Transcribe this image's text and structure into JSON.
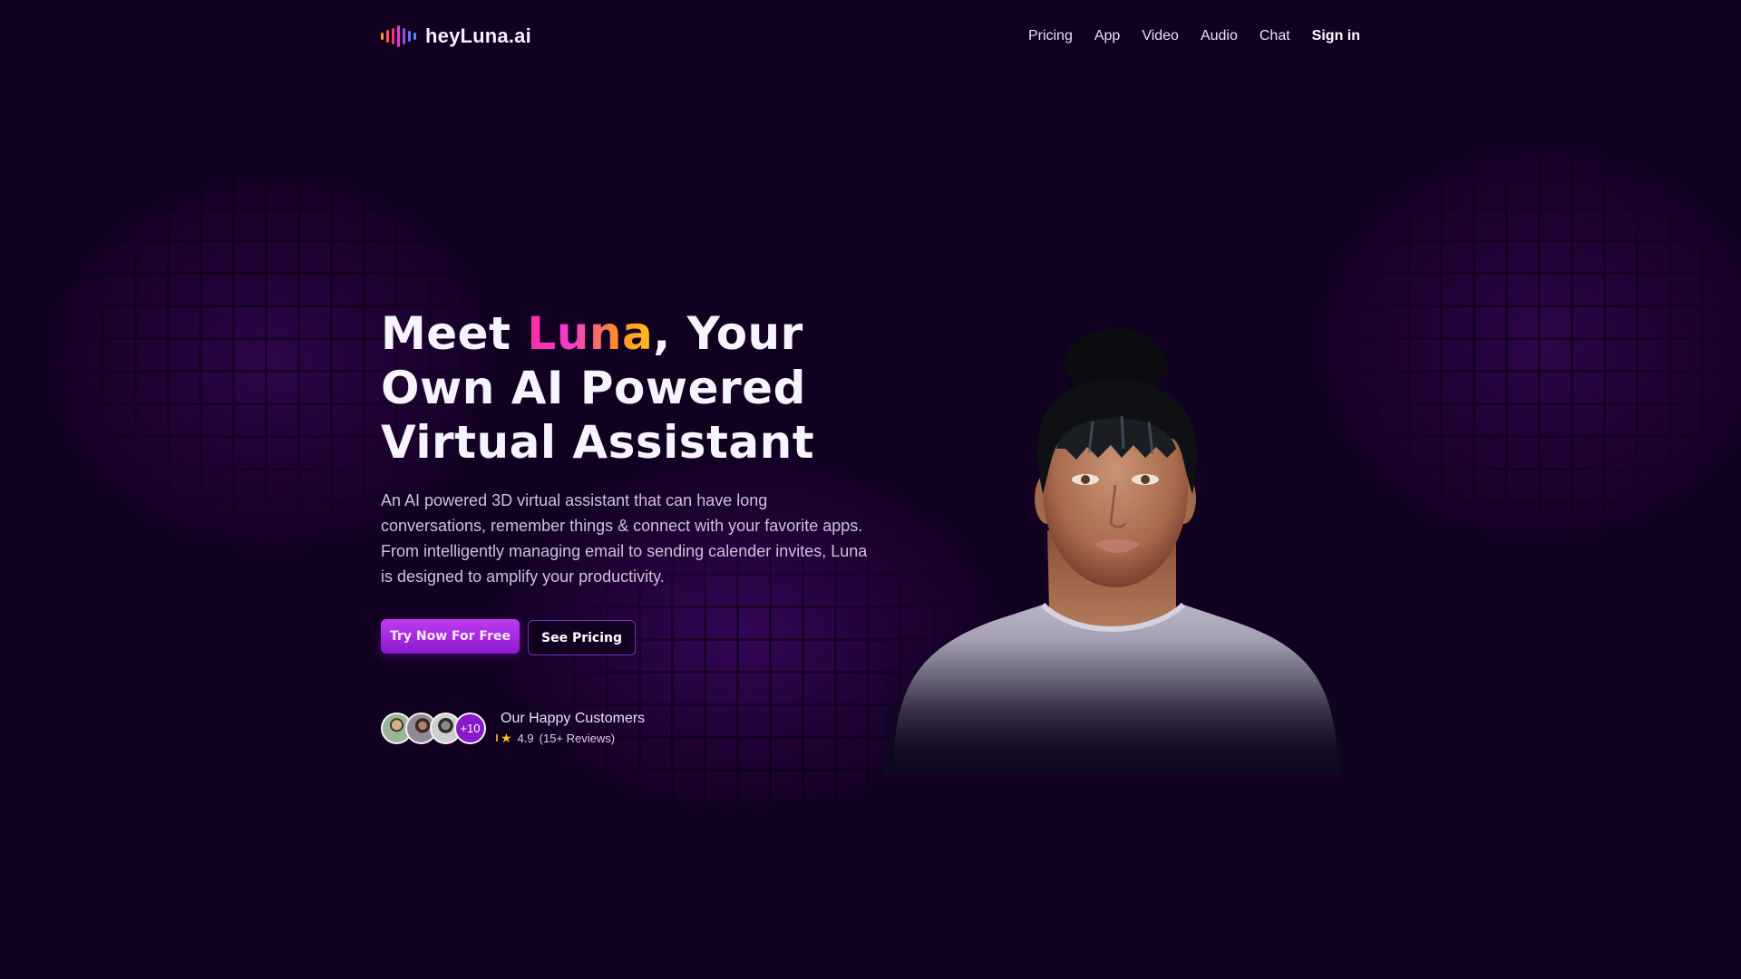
{
  "brand": {
    "name": "heyLuna.ai",
    "logo_icon": "sound-wave-icon",
    "logo_bar_colors": [
      "#ff9a2a",
      "#ff5a3a",
      "#ff2f7a",
      "#e23cd0",
      "#9a4cf0",
      "#6a6cff",
      "#4a8cff"
    ]
  },
  "nav": {
    "links": [
      {
        "label": "Pricing"
      },
      {
        "label": "App"
      },
      {
        "label": "Video"
      },
      {
        "label": "Audio"
      },
      {
        "label": "Chat"
      }
    ],
    "signin_label": "Sign in"
  },
  "hero": {
    "title_before": "Meet ",
    "title_accent": "Luna",
    "title_after": ", Your Own AI Powered Virtual Assistant",
    "description": "An AI powered 3D virtual assistant that can have long conversations, remember things & connect with your favorite apps. From intelligently managing email to sending calender invites, Luna is designed to amplify your productivity.",
    "primary_button": "Try Now For Free",
    "secondary_button": "See Pricing"
  },
  "social_proof": {
    "avatars": [
      {
        "name": "customer-avatar-1"
      },
      {
        "name": "customer-avatar-2"
      },
      {
        "name": "customer-avatar-3"
      }
    ],
    "more_count": "+10",
    "title": "Our Happy Customers",
    "rating": "4.9",
    "reviews": "(15+ Reviews)",
    "star_icon": "star-icon"
  },
  "colors": {
    "background": "#110020",
    "accent_purple": "#8a1ad0",
    "accent_gradient_start": "#ff2fa0",
    "accent_gradient_end": "#ffc21a",
    "star": "#ffc21a"
  },
  "illustration": {
    "subject": "3D virtual assistant Luna portrait"
  }
}
